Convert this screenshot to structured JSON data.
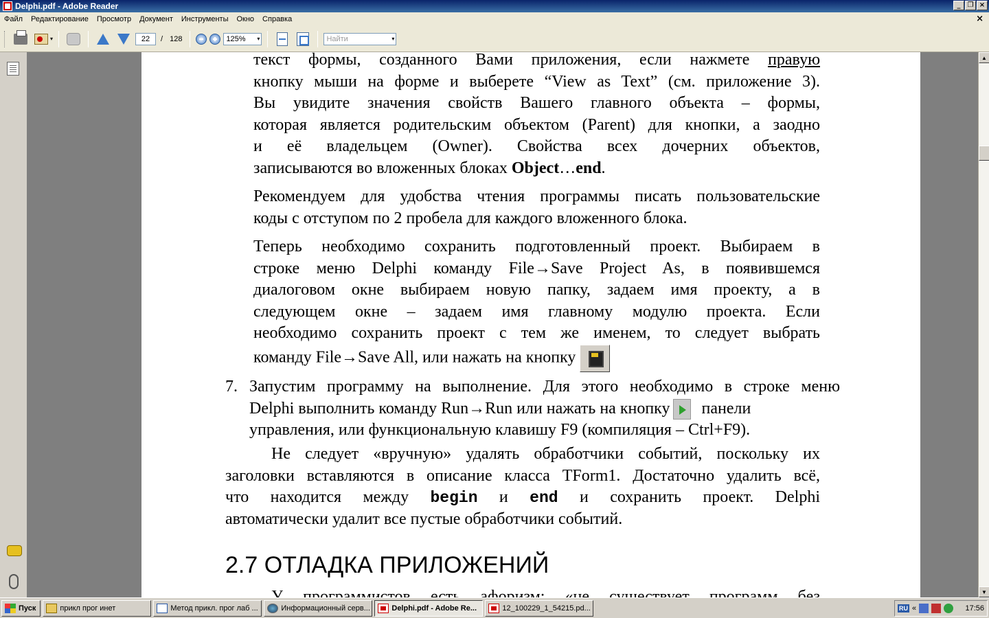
{
  "window": {
    "title": "Delphi.pdf - Adobe Reader",
    "min_label": "_",
    "restore_label": "❐",
    "close_label": "×"
  },
  "menu": {
    "items": [
      "Файл",
      "Редактирование",
      "Просмотр",
      "Документ",
      "Инструменты",
      "Окно",
      "Справка"
    ],
    "doc_close": "×"
  },
  "toolbar": {
    "current_page": "22",
    "page_separator": "/",
    "page_count": "128",
    "zoom": "125%",
    "search_placeholder": "Найти",
    "dropdown_glyph": "▾"
  },
  "document": {
    "para1": [
      "текст формы, созданного Вами приложения, если нажмете ",
      "правую",
      "кнопку мыши на форме и выберете “View as Text” (см. приложение 3).",
      "Вы увидите значения свойств Вашего главного объекта – формы,",
      "которая является родительским объектом (Parent) для кнопки, а заодно",
      "и её владельцем (Owner). Свойства всех дочерних объектов,",
      "записываются во вложенных блоках ",
      "Object",
      "…",
      "end",
      "."
    ],
    "para2": [
      "Рекомендуем для удобства чтения программы писать пользовательские",
      "коды с отступом по 2 пробела для каждого вложенного блока."
    ],
    "para3": [
      "Теперь необходимо сохранить подготовленный проект. Выбираем в",
      "строке меню Delphi команду File→Save Project As, в появившемся",
      "диалоговом окне выбираем новую папку, задаем имя проекту, а в",
      "следующем окне – задаем имя главному модулю проекта. Если",
      "необходимо сохранить проект с тем же именем, то следует выбрать",
      "команду File→Save All, или нажать на кнопку"
    ],
    "item7": {
      "number": "7.",
      "lines": [
        "Запустим программу на выполнение. Для этого необходимо в строке меню",
        "Delphi выполнить команду Run→Run или нажать на кнопку",
        "панели",
        "управления, или функциональную клавишу F9 (компиляция – Ctrl+F9)."
      ]
    },
    "para4": [
      "Не следует «вручную» удалять обработчики событий, поскольку их",
      "заголовки вставляются в описание класса TForm1. Достаточно удалить всё,",
      "что находится между ",
      "begin",
      " и ",
      "end",
      " и сохранить проект. Delphi",
      "автоматически удалит все пустые обработчики событий."
    ],
    "heading": "2.7  ОТЛАДКА ПРИЛОЖЕНИЙ",
    "cut_line": "У программистов есть афоризм: «не существует программ без"
  },
  "scrollbar": {
    "up_glyph": "▲",
    "down_glyph": "▼"
  },
  "taskbar": {
    "start_label": "Пуск",
    "tasks": [
      "прикл прог инет",
      "Метод прикл. прог лаб ...",
      "Информационный серв...",
      "Delphi.pdf - Adobe Re...",
      "12_100229_1_54215.pd..."
    ],
    "tray_lang": "RU",
    "tray_chevron": "«",
    "clock": "17:56"
  }
}
